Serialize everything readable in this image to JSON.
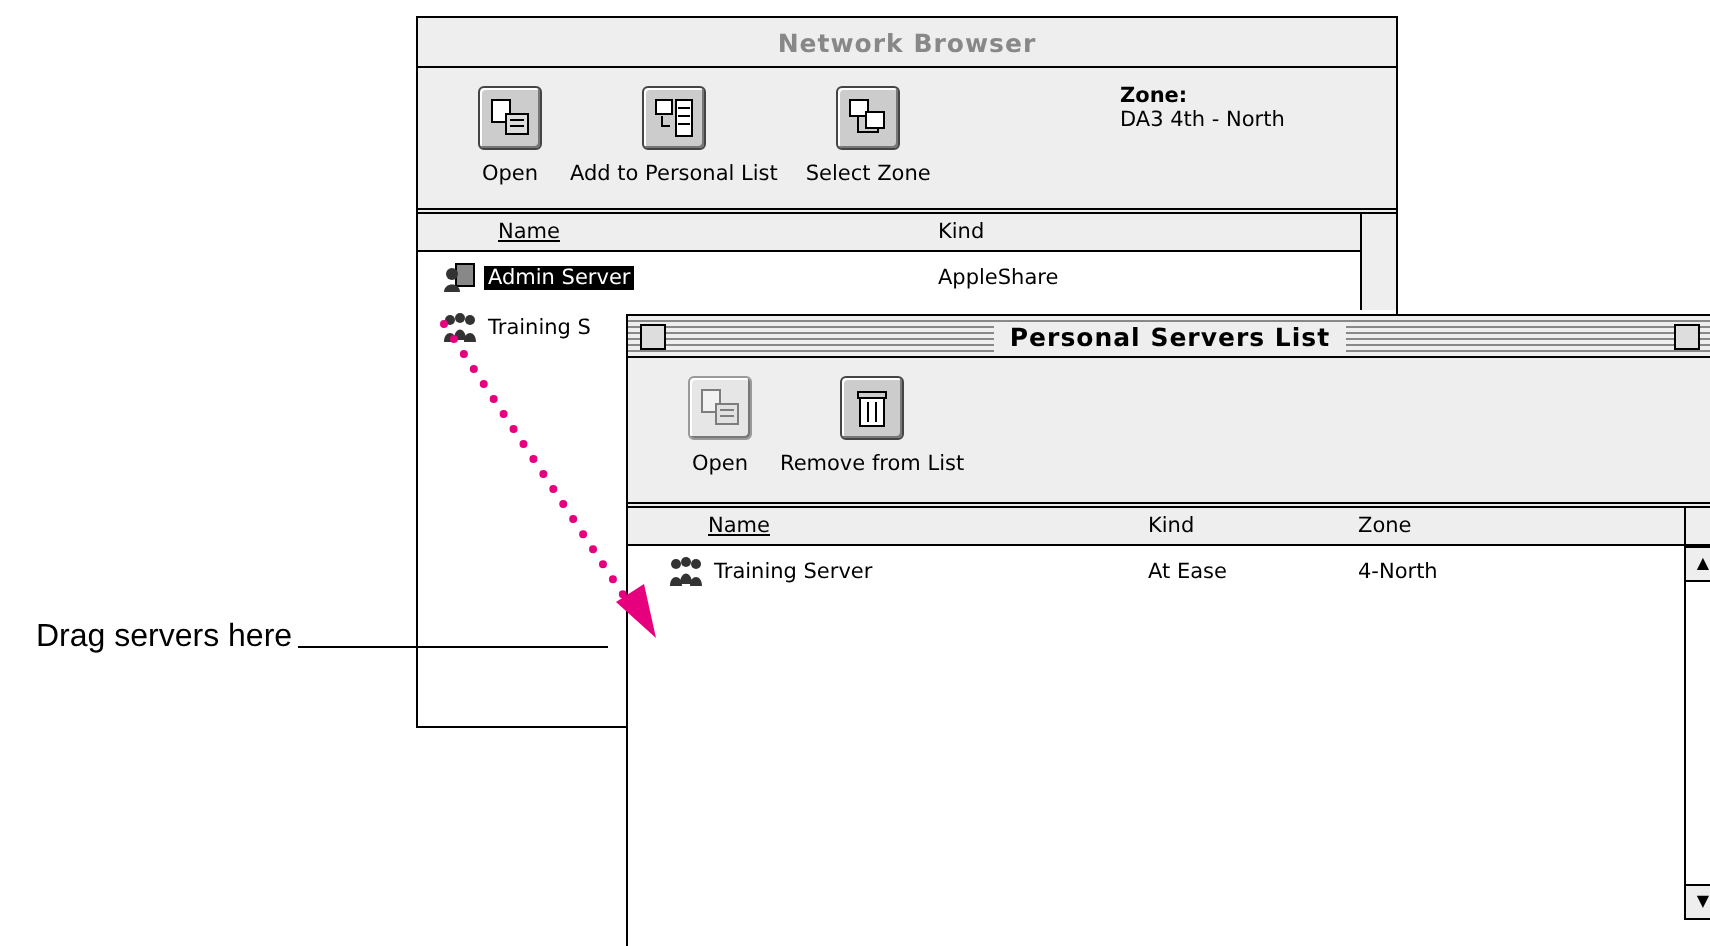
{
  "network_browser": {
    "title": "Network Browser",
    "toolbar": [
      {
        "label": "Open",
        "kind": "open",
        "disabled": false
      },
      {
        "label": "Add to Personal List",
        "kind": "add",
        "disabled": false
      },
      {
        "label": "Select Zone",
        "kind": "zone",
        "disabled": false
      }
    ],
    "zone_label": "Zone:",
    "zone": "DA3 4th - North",
    "columns": [
      "Name",
      "Kind"
    ],
    "rows": [
      {
        "name": "Admin Server",
        "kind": "AppleShare",
        "selected": true
      },
      {
        "name": "Training S",
        "selected": false
      }
    ]
  },
  "personal_list": {
    "title": "Personal Servers List",
    "toolbar": [
      {
        "label": "Open",
        "kind": "open",
        "disabled": true
      },
      {
        "label": "Remove from List",
        "kind": "remove",
        "disabled": false
      }
    ],
    "columns": [
      "Name",
      "Kind",
      "Zone"
    ],
    "rows": [
      {
        "name": "Training Server",
        "kind": "At Ease",
        "zone": "4-North",
        "selected": false
      }
    ]
  },
  "scroll_arrows": [
    "▲",
    "▼"
  ],
  "callout": "Drag servers here"
}
